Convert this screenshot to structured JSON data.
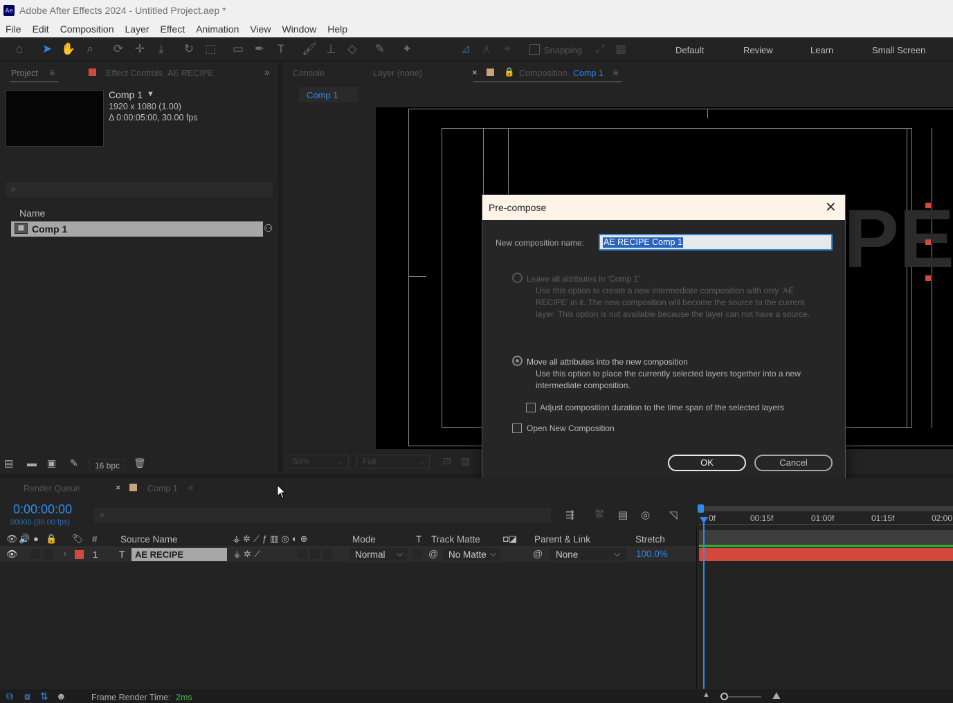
{
  "window": {
    "title": "Adobe After Effects 2024 - Untitled Project.aep *",
    "app_icon_label": "Ae"
  },
  "menu": [
    "File",
    "Edit",
    "Composition",
    "Layer",
    "Effect",
    "Animation",
    "View",
    "Window",
    "Help"
  ],
  "toolbar": {
    "snapping_label": "Snapping",
    "workspaces": [
      "Default",
      "Review",
      "Learn",
      "Small Screen"
    ]
  },
  "project_panel": {
    "tab_project": "Project",
    "tab_effect_controls": "Effect Controls",
    "effect_controls_target": "AE RECIPE",
    "comp_name": "Comp 1",
    "comp_size": "1920 x 1080 (1.00)",
    "comp_duration": "Δ 0:00:05:00, 30.00 fps",
    "column_name": "Name",
    "items": [
      {
        "name": "Comp 1"
      }
    ],
    "bpc": "16 bpc"
  },
  "viewer": {
    "tab_console": "Console",
    "tab_layer": "Layer (none)",
    "tab_composition_prefix": "Composition",
    "tab_composition_name": "Comp 1",
    "sub_tab": "Comp 1",
    "comp_text_fragment": "PE",
    "zoom": "50%",
    "resolution": "Full"
  },
  "dialog": {
    "title": "Pre-compose",
    "name_label": "New composition name:",
    "name_value": "AE RECIPE Comp 1",
    "option1_label": "Leave all attributes in 'Comp 1'",
    "option1_desc": "Use this option to create a new intermediate composition with only 'AE RECIPE' in it. The new composition will become the source to the current layer. This option is not available because the layer can not have a source.",
    "option2_label": "Move all attributes into the new composition",
    "option2_desc": "Use this option to place the currently selected layers together into a new intermediate composition.",
    "adjust_duration_label": "Adjust composition duration to the time span of the selected layers",
    "open_new_label": "Open New Composition",
    "ok_label": "OK",
    "cancel_label": "Cancel"
  },
  "timeline": {
    "tab_render_queue": "Render Queue",
    "tab_comp": "Comp 1",
    "timecode": "0:00:00:00",
    "frame_info": "00000 (30.00 fps)",
    "columns": {
      "number": "#",
      "source_name": "Source Name",
      "mode": "Mode",
      "t": "T",
      "track_matte": "Track Matte",
      "parent_link": "Parent & Link",
      "stretch": "Stretch"
    },
    "layers": [
      {
        "number": "1",
        "type": "T",
        "name": "AE RECIPE",
        "mode": "Normal",
        "track_matte": "No Matte",
        "parent": "None",
        "stretch": "100.0%"
      }
    ],
    "ruler_labels": [
      "0f",
      "00:15f",
      "01:00f",
      "01:15f",
      "02:00"
    ],
    "layer_color": "#d24a3e"
  },
  "statusbar": {
    "frame_render_label": "Frame Render Time:",
    "frame_render_value": "2ms"
  },
  "colors": {
    "accent": "#2d8ceb",
    "label_red": "#d24a3e",
    "comp_label": "#c8a27a"
  }
}
